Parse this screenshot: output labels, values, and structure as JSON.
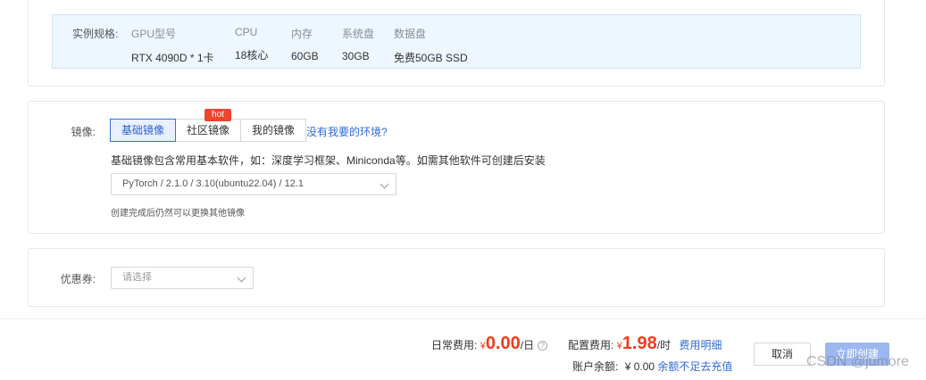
{
  "spec": {
    "label": "实例规格:",
    "columns": [
      {
        "header": "GPU型号",
        "value": "RTX 4090D * 1卡"
      },
      {
        "header": "CPU",
        "value": "18核心"
      },
      {
        "header": "内存",
        "value": "60GB"
      },
      {
        "header": "系统盘",
        "value": "30GB"
      },
      {
        "header": "数据盘",
        "value": "免费50GB SSD"
      }
    ]
  },
  "image": {
    "label": "镜像:",
    "tabs": [
      {
        "label": "基础镜像",
        "active": true
      },
      {
        "label": "社区镜像",
        "badge": "hot"
      },
      {
        "label": "我的镜像"
      }
    ],
    "env_link": "没有我要的环境?",
    "description": "基础镜像包含常用基本软件，如：深度学习框架、Miniconda等。如需其他软件可创建后安装",
    "selected": "PyTorch / 2.1.0 / 3.10(ubuntu22.04) / 12.1",
    "hint": "创建完成后仍然可以更换其他镜像"
  },
  "coupon": {
    "label": "优惠券:",
    "placeholder": "请选择"
  },
  "footer": {
    "daily_label": "日常费用:",
    "daily_currency": "¥",
    "daily_price": "0.00",
    "daily_unit": "/日",
    "config_label": "配置费用:",
    "config_currency": "¥",
    "config_price": "1.98",
    "config_unit": "/时",
    "fee_detail": "费用明细",
    "balance_label": "账户余额:",
    "balance_value": "¥ 0.00",
    "recharge_link": "余额不足去充值",
    "cancel": "取消",
    "create": "立即创建",
    "watermark": "CSDN @jumore"
  },
  "colors": {
    "accent": "#2f6bd8",
    "price": "#f23c1b",
    "hot_badge": "#f0442f",
    "spec_bg": "#eef6ff"
  }
}
